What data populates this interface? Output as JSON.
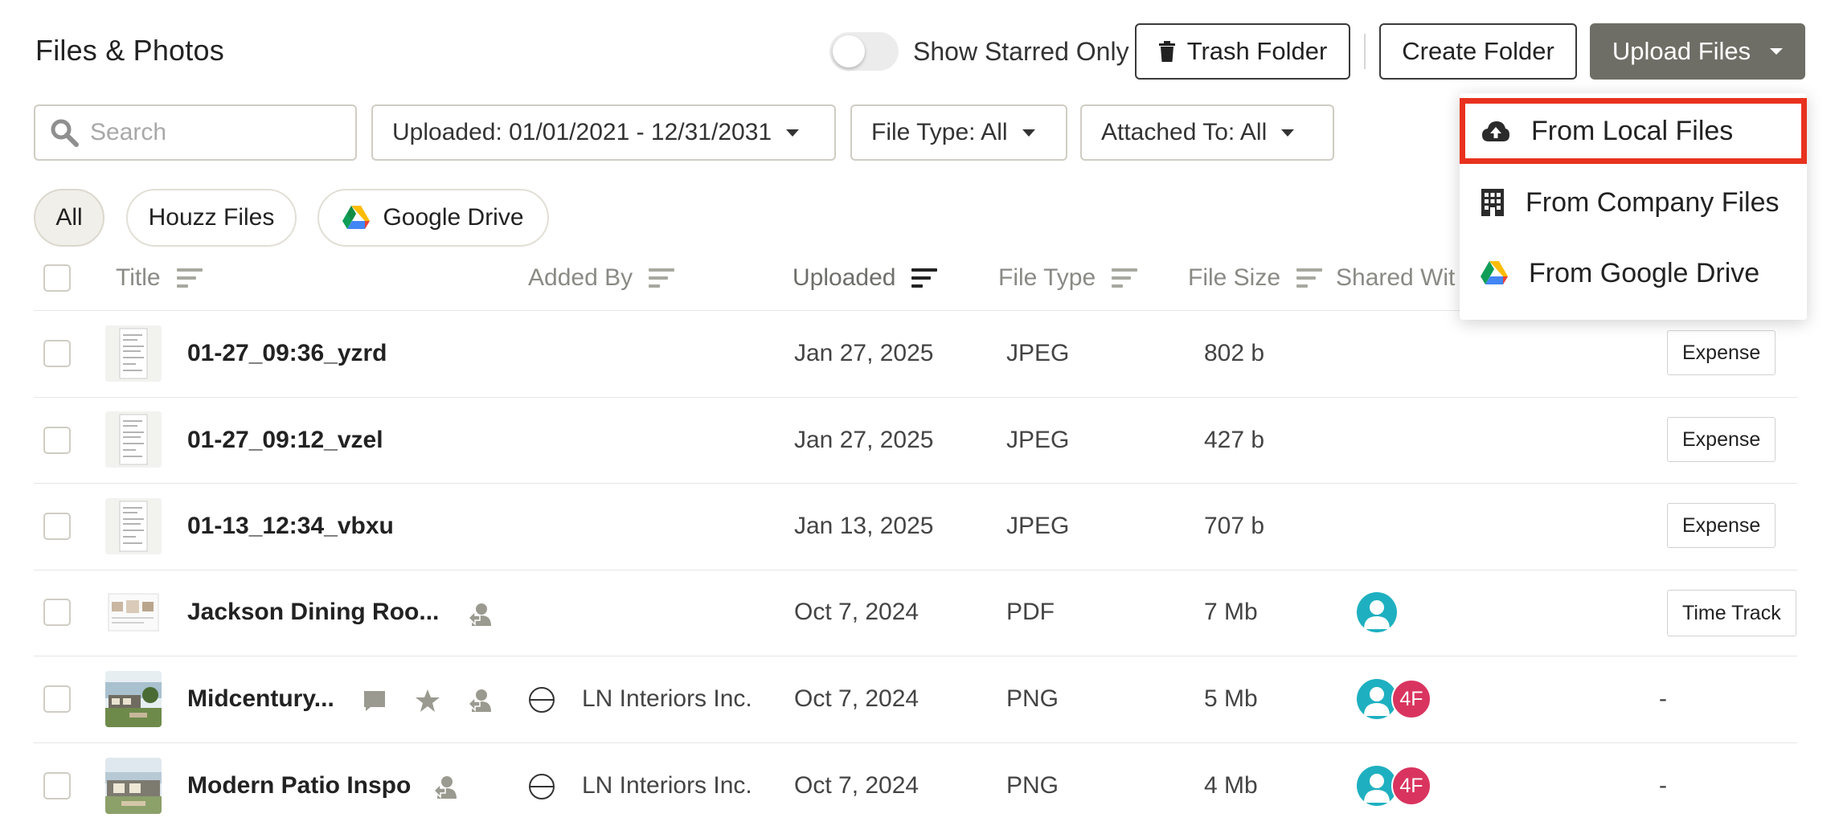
{
  "header": {
    "title": "Files & Photos",
    "starred_toggle_label": "Show Starred Only",
    "trash_label": "Trash Folder",
    "create_label": "Create Folder",
    "upload_label": "Upload Files"
  },
  "filters": {
    "search_placeholder": "Search",
    "uploaded": "Uploaded: 01/01/2021 - 12/31/2031",
    "file_type": "File Type: All",
    "attached_to": "Attached To: All"
  },
  "sources": [
    "All",
    "Houzz Files",
    "Google Drive"
  ],
  "columns": {
    "title": "Title",
    "added_by": "Added By",
    "uploaded": "Uploaded",
    "file_type": "File Type",
    "file_size": "File Size",
    "shared_with": "Shared Wit"
  },
  "rows": [
    {
      "title": "01-27_09:36_yzrd",
      "added_by": "",
      "uploaded": "Jan 27, 2025",
      "type": "JPEG",
      "size": "802 b",
      "attached": "Expense"
    },
    {
      "title": "01-27_09:12_vzel",
      "added_by": "",
      "uploaded": "Jan 27, 2025",
      "type": "JPEG",
      "size": "427 b",
      "attached": "Expense"
    },
    {
      "title": "01-13_12:34_vbxu",
      "added_by": "",
      "uploaded": "Jan 13, 2025",
      "type": "JPEG",
      "size": "707 b",
      "attached": "Expense"
    },
    {
      "title": "Jackson Dining Roo...",
      "added_by": "",
      "uploaded": "Oct 7, 2024",
      "type": "PDF",
      "size": "7 Mb",
      "attached": "Time Track"
    },
    {
      "title": "Midcentury...",
      "added_by": "LN Interiors Inc.",
      "uploaded": "Oct 7, 2024",
      "type": "PNG",
      "size": "5 Mb",
      "attached": "-",
      "shared_initials": "4F"
    },
    {
      "title": "Modern Patio Inspo",
      "added_by": "LN Interiors Inc.",
      "uploaded": "Oct 7, 2024",
      "type": "PNG",
      "size": "4 Mb",
      "attached": "-",
      "shared_initials": "4F"
    }
  ],
  "upload_menu": {
    "local": "From Local Files",
    "company": "From Company Files",
    "gdrive": "From Google Drive"
  },
  "colors": {
    "upload_button": "#6f6e66",
    "highlight_border": "#e8321f",
    "avatar_teal": "#1eb0c0",
    "avatar_pink": "#d9345f"
  }
}
